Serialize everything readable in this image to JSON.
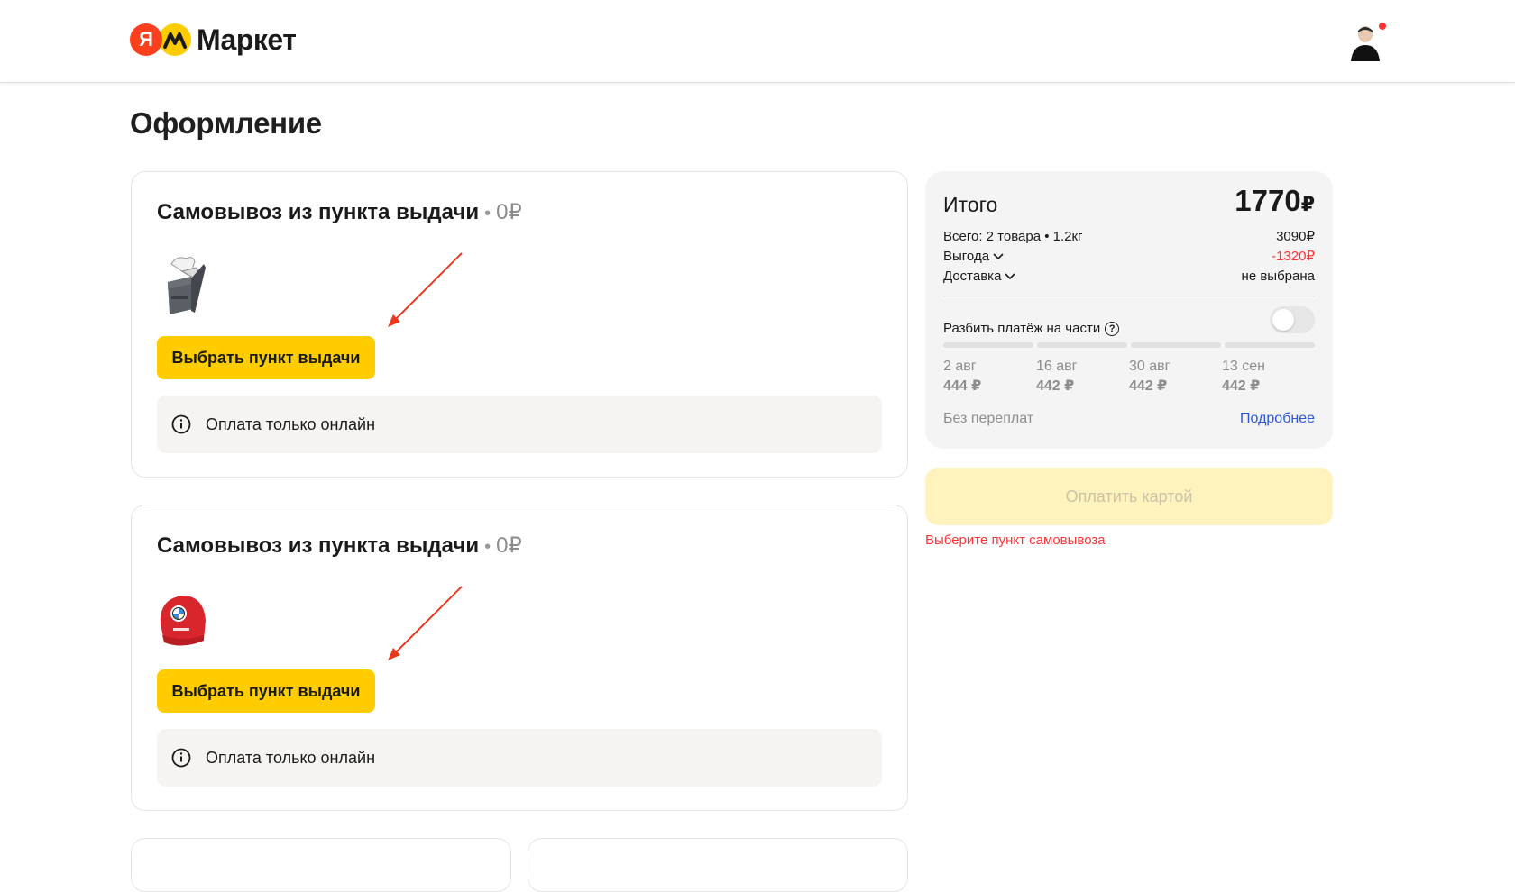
{
  "header": {
    "logo_ya": "Я",
    "logo_text": "Маркет",
    "avatar_icon": "user-avatar",
    "notification_dot_color": "#ff3333"
  },
  "page": {
    "title": "Оформление"
  },
  "deliveries": [
    {
      "title": "Самовывоз из пункта выдачи",
      "price": "0₽",
      "product_icon": "bag-product-image",
      "button_label": "Выбрать пункт выдачи",
      "info": "Оплата только онлайн"
    },
    {
      "title": "Самовывоз из пункта выдачи",
      "price": "0₽",
      "product_icon": "red-cap-product-image",
      "button_label": "Выбрать пункт выдачи",
      "info": "Оплата только онлайн"
    }
  ],
  "summary": {
    "title": "Итого",
    "total": "1770",
    "currency": "₽",
    "rows": [
      {
        "label": "Всего: 2 товара • 1.2кг",
        "value": "3090₽"
      },
      {
        "label": "Выгода",
        "value": "-1320₽"
      },
      {
        "label": "Доставка",
        "value": "не выбрана"
      }
    ],
    "split_label": "Разбить платёж на части",
    "split_enabled": false,
    "installments": [
      {
        "date": "2 авг",
        "sum": "444 ₽"
      },
      {
        "date": "16 авг",
        "sum": "442 ₽"
      },
      {
        "date": "30 авг",
        "sum": "442 ₽"
      },
      {
        "date": "13 сен",
        "sum": "442 ₽"
      }
    ],
    "no_overpay": "Без переплат",
    "more_link": "Подробнее"
  },
  "pay": {
    "button_label": "Оплатить картой",
    "warning": "Выберите пункт самовывоза"
  },
  "colors": {
    "accent_yellow": "#ffcc00",
    "warning_red": "#ff3333",
    "link_blue": "#2b57d9"
  }
}
